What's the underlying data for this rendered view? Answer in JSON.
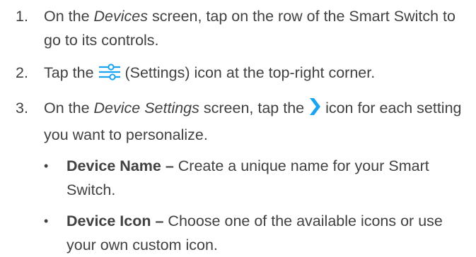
{
  "steps": [
    {
      "number": "1.",
      "parts": {
        "a": "On the ",
        "b": "Devices",
        "c": " screen, tap on the row of the Smart Switch to go to its controls."
      }
    },
    {
      "number": "2.",
      "parts": {
        "a": "Tap the ",
        "icon": "settings-sliders-icon",
        "c": " (Settings) icon at the top-right corner."
      }
    },
    {
      "number": "3.",
      "parts": {
        "a": "On the ",
        "b": "Device Settings",
        "c": " screen, tap the ",
        "icon": "chevron-right-icon",
        "d": " icon for each setting you want to personalize."
      }
    }
  ],
  "bullets": [
    {
      "marker": "•",
      "term": "Device Name –",
      "desc": " Create a unique name for your Smart Switch."
    },
    {
      "marker": "•",
      "term": "Device Icon –",
      "desc": " Choose one of the available icons or use your own custom icon."
    }
  ],
  "colors": {
    "text": "#414142",
    "accent": "#1aa3f0"
  }
}
